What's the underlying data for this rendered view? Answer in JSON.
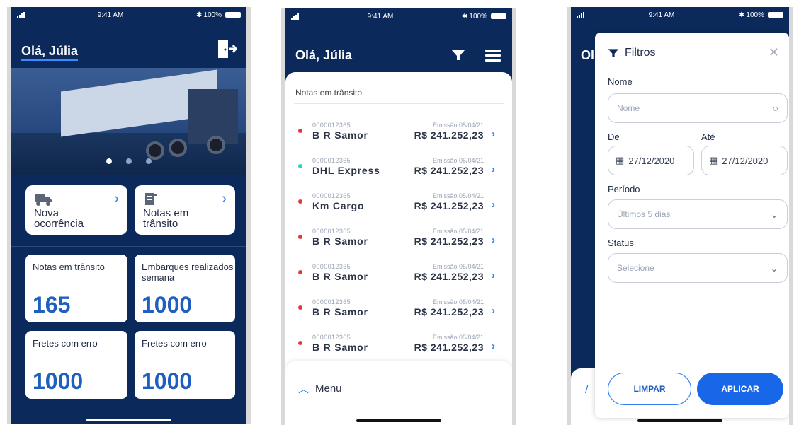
{
  "status": {
    "time": "9:41 AM",
    "battery": "100%"
  },
  "home": {
    "greeting": "Olá, Júlia",
    "tiles": [
      {
        "label": "Nova ocorrência",
        "icon": "truck-icon"
      },
      {
        "label": "Notas em trânsito",
        "icon": "document-icon"
      }
    ],
    "stats": [
      {
        "title": "Notas em trânsito",
        "value": "165"
      },
      {
        "title": "Embarques realizados semana",
        "value": "1000"
      },
      {
        "title": "Fretes com erro",
        "value": "1000"
      },
      {
        "title": "Fretes com erro",
        "value": "1000"
      }
    ]
  },
  "list": {
    "greeting": "Olá, Júlia",
    "subtitle": "Notas em trânsito",
    "items": [
      {
        "code": "0000012365",
        "name": "B R Samor",
        "emission": "Emissão 05/04/21",
        "value": "R$ 241.252,23",
        "status_color": "#e53935"
      },
      {
        "code": "0000012365",
        "name": "DHL Express",
        "emission": "Emissão 05/04/21",
        "value": "R$ 241.252,23",
        "status_color": "#26d7c4"
      },
      {
        "code": "0000012365",
        "name": "Km Cargo",
        "emission": "Emissão 05/04/21",
        "value": "R$ 241.252,23",
        "status_color": "#e53935"
      },
      {
        "code": "0000012365",
        "name": "B R Samor",
        "emission": "Emissão 05/04/21",
        "value": "R$ 241.252,23",
        "status_color": "#e53935"
      },
      {
        "code": "0000012365",
        "name": "B R Samor",
        "emission": "Emissão 05/04/21",
        "value": "R$ 241.252,23",
        "status_color": "#e53935"
      },
      {
        "code": "0000012365",
        "name": "B R Samor",
        "emission": "Emissão 05/04/21",
        "value": "R$ 241.252,23",
        "status_color": "#e53935"
      },
      {
        "code": "0000012365",
        "name": "B R Samor",
        "emission": "Emissão 05/04/21",
        "value": "R$ 241.252,23",
        "status_color": "#e53935"
      }
    ],
    "menu_label": "Menu"
  },
  "filters": {
    "greeting_partial": "Ol",
    "title": "Filtros",
    "name_label": "Nome",
    "name_placeholder": "Nome",
    "from_label": "De",
    "to_label": "Até",
    "from_date": "27/12/2020",
    "to_date": "27/12/2020",
    "period_label": "Período",
    "period_value": "Últimos 5 dias",
    "status_label": "Status",
    "status_placeholder": "Selecione",
    "clear_label": "LIMPAR",
    "apply_label": "APLICAR"
  },
  "colors": {
    "navy": "#0b2a5b",
    "accent": "#2f7df6",
    "number": "#1f5fbf"
  }
}
